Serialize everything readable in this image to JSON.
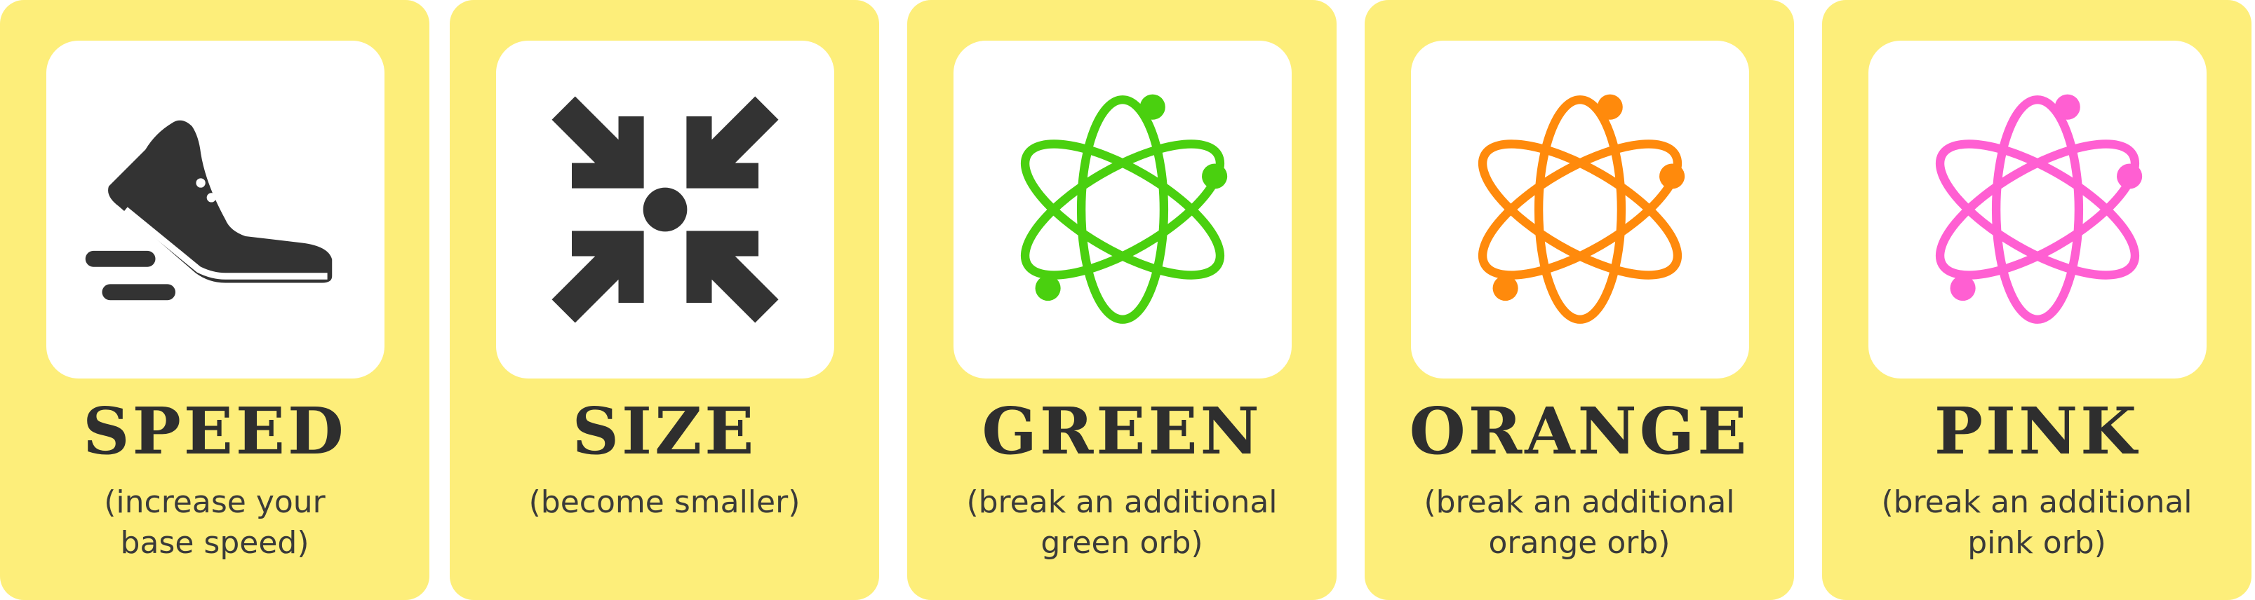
{
  "cards": [
    {
      "title": "SPEED",
      "desc_line1": "(increase your",
      "desc_line2": "base speed)",
      "icon": "shoe-icon",
      "icon_color": "#333333"
    },
    {
      "title": "SIZE",
      "desc_line1": "(become smaller)",
      "desc_line2": "",
      "icon": "shrink-arrows-icon",
      "icon_color": "#333333"
    },
    {
      "title": "GREEN",
      "desc_line1": "(break an additional",
      "desc_line2": "green orb)",
      "icon": "atom-icon",
      "icon_color": "#4ad00f"
    },
    {
      "title": "ORANGE",
      "desc_line1": "(break an additional",
      "desc_line2": "orange orb)",
      "icon": "atom-icon",
      "icon_color": "#ff8a0c"
    },
    {
      "title": "PINK",
      "desc_line1": "(break an additional",
      "desc_line2": "pink orb)",
      "icon": "atom-icon",
      "icon_color": "#ff5fd2"
    }
  ],
  "colors": {
    "card_background": "#fdee7a",
    "icon_box_background": "#ffffff",
    "title_text": "#2e2e2e"
  }
}
